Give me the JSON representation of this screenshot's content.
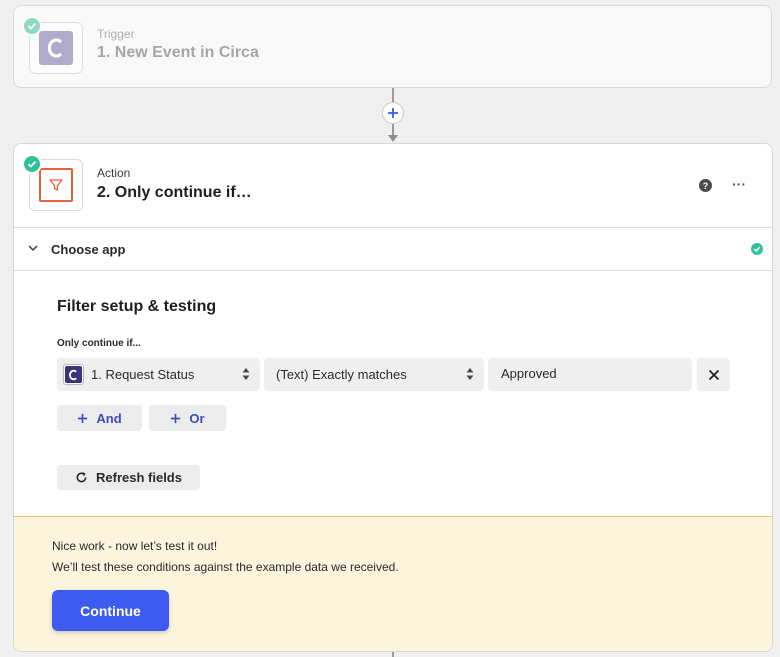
{
  "trigger": {
    "kind": "Trigger",
    "title": "1. New Event in Circa",
    "app_icon": "circa-logo-icon",
    "status_icon": "check-circle-icon"
  },
  "connector": {
    "add_icon": "plus-icon"
  },
  "action": {
    "kind": "Action",
    "title": "2. Only continue if…",
    "app_icon": "filter-funnel-icon",
    "help_glyph": "?",
    "more_glyph": "···"
  },
  "choose_app": {
    "label": "Choose app",
    "status_icon": "check-circle-icon"
  },
  "filter": {
    "heading": "Filter setup & testing",
    "label": "Only continue if...",
    "field_value": "1. Request Status",
    "condition_value": "(Text) Exactly matches",
    "compare_value": "Approved",
    "and_label": "And",
    "or_label": "Or",
    "refresh_label": "Refresh fields"
  },
  "notice": {
    "line1": "Nice work - now let’s test it out!",
    "line2": "We’ll test these conditions against the example data we received.",
    "continue_label": "Continue"
  },
  "colors": {
    "accent": "#3d5af1",
    "success": "#2ec29a",
    "filter_brand": "#e8603c",
    "circa_brand": "#3b3280",
    "notice_bg": "#fcf4dd"
  }
}
